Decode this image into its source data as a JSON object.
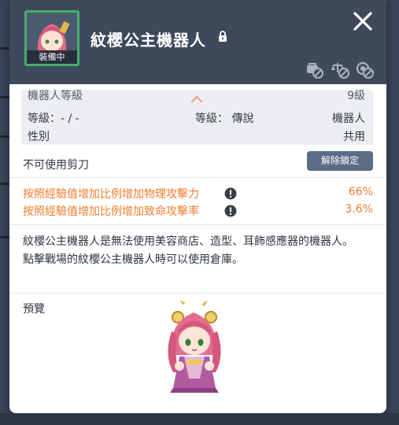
{
  "item": {
    "name": "紋櫻公主機器人",
    "equipped_badge": "裝備中"
  },
  "stats": {
    "row1_label": "機器人等級",
    "row1_value": "9級",
    "grade_label": "等級：- / -",
    "rarity_label": "等級： 傳說",
    "type_value": "機器人",
    "gender_label": "性別",
    "gender_value": "共用"
  },
  "scissors": {
    "text": "不可使用剪刀",
    "unlock_button": "解除鎖定"
  },
  "bonuses": [
    {
      "label": "按照經驗值增加比例增加物理攻擊力",
      "value": "66%"
    },
    {
      "label": "按照經驗值增加比例增加致命攻擊率",
      "value": "3.6%"
    }
  ],
  "description": {
    "line1": "紋櫻公主機器人是無法使用美容商店、造型、耳飾感應器的機器人。",
    "line2": "點擊戰場的紋櫻公主機器人時可以使用倉庫。"
  },
  "preview": {
    "label": "預覽"
  },
  "colors": {
    "header_bg": "#3e495c",
    "accent_orange": "#ee7d2e",
    "equipped_border": "#43b06a",
    "button_bg": "#5d6c86"
  },
  "icons": {
    "close": "close-icon",
    "lock": "lock-icon",
    "trade_block": "trade-block-icon",
    "scale_block": "scale-block-icon",
    "recycle_block": "recycle-block-icon",
    "info": "info-icon",
    "collapse": "chevron-up-icon"
  }
}
